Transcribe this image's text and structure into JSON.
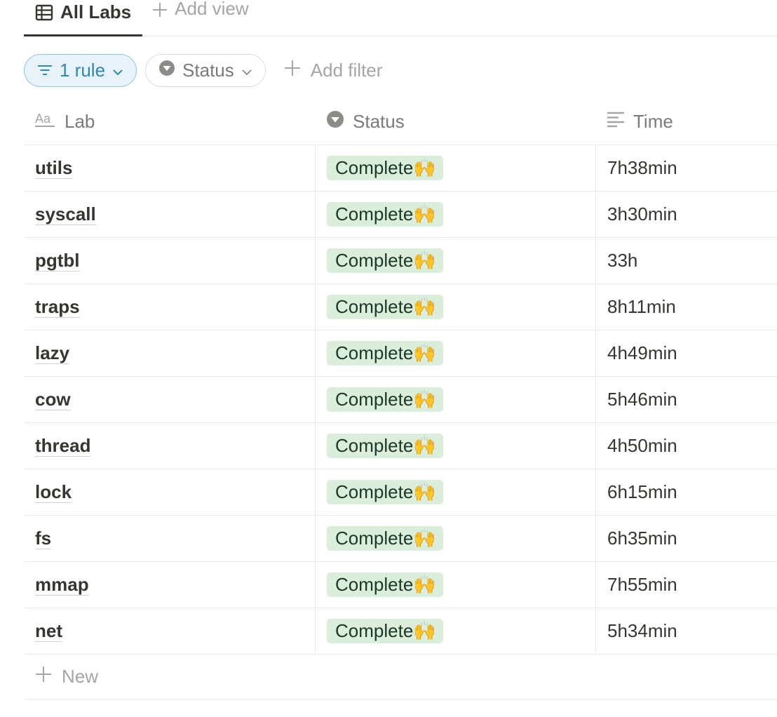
{
  "view_tabs": {
    "active_label": "All Labs",
    "add_label": "Add view"
  },
  "filters": {
    "rule_label": "1 rule",
    "status_label": "Status",
    "add_label": "Add filter"
  },
  "table": {
    "columns": {
      "lab": "Lab",
      "status": "Status",
      "time": "Time"
    },
    "rows": [
      {
        "lab": "utils",
        "status": "Complete🙌",
        "time": "7h38min"
      },
      {
        "lab": "syscall",
        "status": "Complete🙌",
        "time": "3h30min"
      },
      {
        "lab": "pgtbl",
        "status": "Complete🙌",
        "time": "33h"
      },
      {
        "lab": "traps",
        "status": "Complete🙌",
        "time": "8h11min"
      },
      {
        "lab": "lazy",
        "status": "Complete🙌",
        "time": "4h49min"
      },
      {
        "lab": "cow",
        "status": "Complete🙌",
        "time": "5h46min"
      },
      {
        "lab": "thread",
        "status": "Complete🙌",
        "time": "4h50min"
      },
      {
        "lab": "lock",
        "status": "Complete🙌",
        "time": "6h15min"
      },
      {
        "lab": "fs",
        "status": "Complete🙌",
        "time": "6h35min"
      },
      {
        "lab": "mmap",
        "status": "Complete🙌",
        "time": "7h55min"
      },
      {
        "lab": "net",
        "status": "Complete🙌",
        "time": "5h34min"
      }
    ],
    "new_label": "New"
  },
  "colors": {
    "status_badge_bg": "#dbeddb",
    "rule_pill_accent": "#2e87b5"
  }
}
